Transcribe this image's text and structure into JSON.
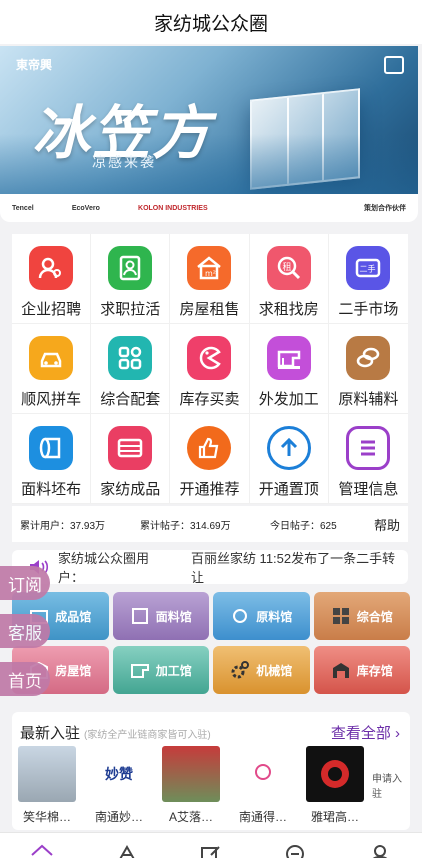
{
  "header": {
    "title": "家纺城公众圈"
  },
  "banner": {
    "brand": "東帝興",
    "headline": "冰笠方",
    "tagline": "凉感来袭"
  },
  "partners": {
    "items": [
      "Tencel",
      "EcoVero",
      "KOLON INDUSTRIES"
    ],
    "sponsor": "策划合作伙伴"
  },
  "categories": [
    {
      "label": "企业招聘",
      "icon": "recruit-icon",
      "color": "#f0443f"
    },
    {
      "label": "求职拉活",
      "icon": "resume-icon",
      "color": "#2fb54e"
    },
    {
      "label": "房屋租售",
      "icon": "house-icon",
      "color": "#f56a2b"
    },
    {
      "label": "求租找房",
      "icon": "rent-search-icon",
      "color": "#f0576d"
    },
    {
      "label": "二手市场",
      "icon": "second-hand-icon",
      "color": "#5a55e6"
    },
    {
      "label": "顺风拼车",
      "icon": "car-icon",
      "color": "#f6a81c"
    },
    {
      "label": "综合配套",
      "icon": "apps-icon",
      "color": "#22b6b0"
    },
    {
      "label": "库存买卖",
      "icon": "pacman-icon",
      "color": "#ef3f6a"
    },
    {
      "label": "外发加工",
      "icon": "sewing-machine-icon",
      "color": "#c34fd9"
    },
    {
      "label": "原料辅料",
      "icon": "yarn-icon",
      "color": "#b87a44"
    },
    {
      "label": "面料坯布",
      "icon": "fabric-roll-icon",
      "color": "#1d8fe0"
    },
    {
      "label": "家纺成品",
      "icon": "bedding-icon",
      "color": "#ea3e63"
    },
    {
      "label": "开通推荐",
      "icon": "thumbs-up-icon",
      "color": "#f26a1b"
    },
    {
      "label": "开通置顶",
      "icon": "arrow-up-icon",
      "color": "#1c7fd8"
    },
    {
      "label": "管理信息",
      "icon": "list-icon",
      "color": "#9b3fc9"
    }
  ],
  "stats": {
    "users": "累计用户：37.93万",
    "posts": "累计帖子：314.69万",
    "today": "今日帖子：625",
    "help": "帮助"
  },
  "notice": {
    "user": "家纺城公众圈用户：",
    "message": "百丽丝家纺 11:52发布了一条二手转让"
  },
  "halls": [
    {
      "label": "成品馆",
      "color": "#5fa8d3"
    },
    {
      "label": "面料馆",
      "color": "#a589c2"
    },
    {
      "label": "原料馆",
      "color": "#5aa7d9"
    },
    {
      "label": "综合馆",
      "color": "#d89360"
    },
    {
      "label": "房屋馆",
      "color": "#e27d93"
    },
    {
      "label": "加工馆",
      "color": "#5fb9a7"
    },
    {
      "label": "机械馆",
      "color": "#e6a64f"
    },
    {
      "label": "库存馆",
      "color": "#e46b62"
    }
  ],
  "floats": {
    "subscribe": "订阅",
    "service": "客服",
    "home": "首页"
  },
  "newest": {
    "title": "最新入驻",
    "hint": "(家纺全产业链商家皆可入驻)",
    "more": "查看全部",
    "firms": [
      {
        "name": "笑华棉…"
      },
      {
        "name": "南通妙…",
        "logo_text": "妙赞"
      },
      {
        "name": "A艾落…"
      },
      {
        "name": "南通得…"
      },
      {
        "name": "雅珺高…"
      }
    ],
    "apply": "申请入驻"
  }
}
